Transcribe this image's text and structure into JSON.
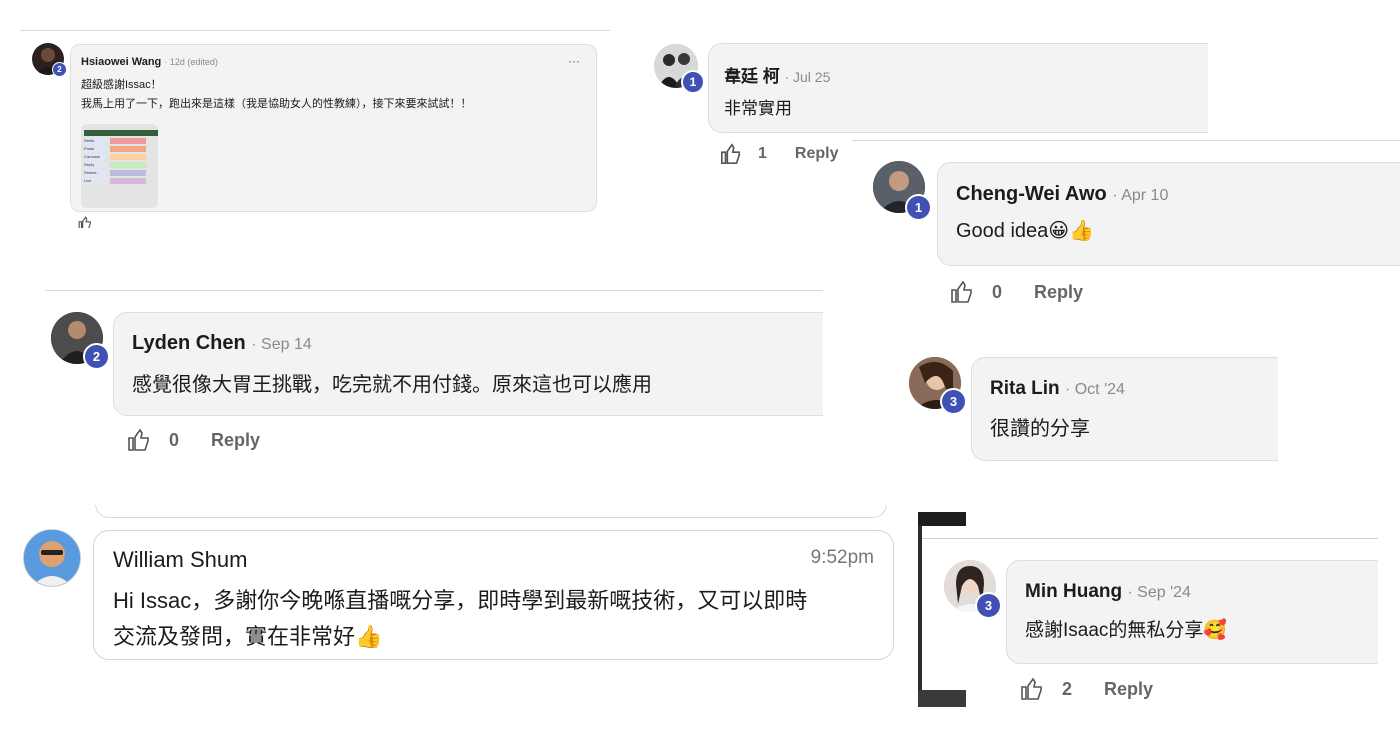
{
  "comments": {
    "hsiaowei": {
      "name": "Hsiaowei Wang",
      "meta": "· 12d (edited)",
      "badge": "2",
      "line1": "超級感謝Issac！",
      "line2": "我馬上用了一下，跑出來是這樣（我是協助女人的性教練），接下來要來試試！！",
      "more": "···"
    },
    "wei": {
      "name": "韋廷 柯",
      "meta": "· Jul 25",
      "badge": "1",
      "message": "非常實用",
      "likes": "1",
      "reply": "Reply"
    },
    "chengwei": {
      "name": "Cheng-Wei Awo",
      "meta": "· Apr 10",
      "badge": "1",
      "message": "Good idea😀👍",
      "likes": "0",
      "reply": "Reply"
    },
    "lyden": {
      "name": "Lyden Chen",
      "meta": "· Sep 14",
      "badge": "2",
      "message": "感覺很像大胃王挑戰，吃完就不用付錢。原來這也可以應用",
      "likes": "0",
      "reply": "Reply"
    },
    "rita": {
      "name": "Rita Lin",
      "meta": "· Oct '24",
      "badge": "3",
      "message": "很讚的分享"
    },
    "william": {
      "name": "William Shum",
      "time": "9:52pm",
      "line1": "Hi Issac，多謝你今晚喺直播嘅分享，即時學到最新嘅技術，又可以即時",
      "line2": "交流及發問，實在非常好👍"
    },
    "min": {
      "name": "Min Huang",
      "meta": "· Sep '24",
      "badge": "3",
      "message": "感謝Isaac的無私分享🥰",
      "likes": "2",
      "reply": "Reply"
    }
  },
  "thumbnail": {
    "rows": [
      "Reels",
      "Posts",
      "Carousel",
      "Reply",
      "Stories",
      "Live"
    ]
  },
  "colors": {
    "badge": "#3f51b5",
    "card": "#f3f3f3",
    "meta": "#8a8a8a"
  },
  "icons": {
    "like": "thumbs-up-outline-icon",
    "more": "ellipsis-icon"
  }
}
